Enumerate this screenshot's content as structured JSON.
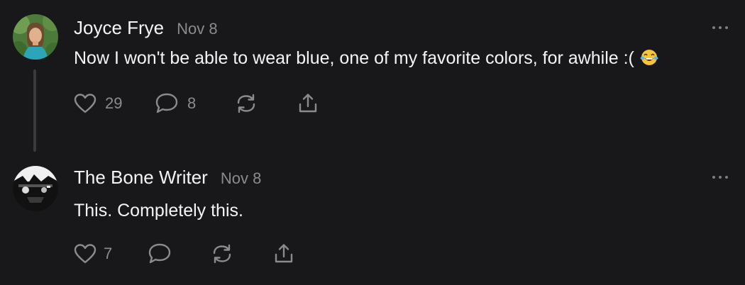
{
  "comments": [
    {
      "author": "Joyce Frye",
      "date": "Nov 8",
      "text": "Now I won't be able to wear blue, one of my favorite colors, for awhile :(",
      "emoji": "laughing-tears-emoji",
      "likes": "29",
      "replies": "8"
    },
    {
      "author": "The Bone Writer",
      "date": "Nov 8",
      "text": "This. Completely this.",
      "likes": "7"
    }
  ],
  "icons": {
    "like": "heart-icon",
    "reply": "speech-bubble-icon",
    "restack": "restack-icon",
    "share": "share-icon",
    "more": "more-options-icon"
  },
  "colors": {
    "background": "#18181a",
    "text": "#f4f4f4",
    "muted": "#8b8b8f",
    "thread_line": "#3a3a3d"
  }
}
